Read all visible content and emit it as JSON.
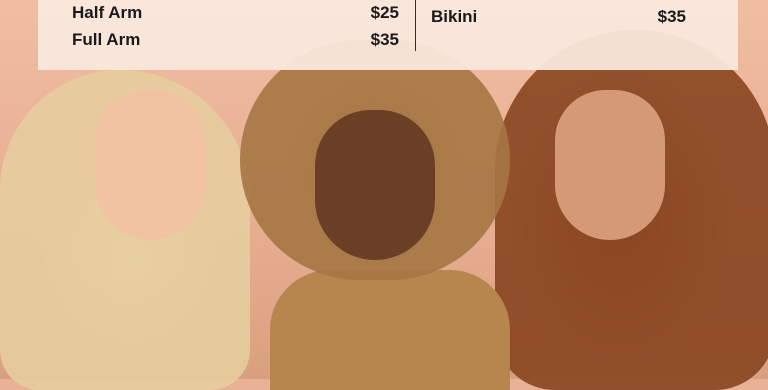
{
  "pricing": {
    "left_items": [
      {
        "name": "Half Arm",
        "price": "$25"
      },
      {
        "name": "Full Arm",
        "price": "$35"
      }
    ],
    "right_items": [
      {
        "name": "Bikini",
        "price": "$35"
      }
    ]
  },
  "colors": {
    "panel_bg": "#fae9de",
    "text": "#1a1a1a",
    "background": "#e9b196"
  }
}
